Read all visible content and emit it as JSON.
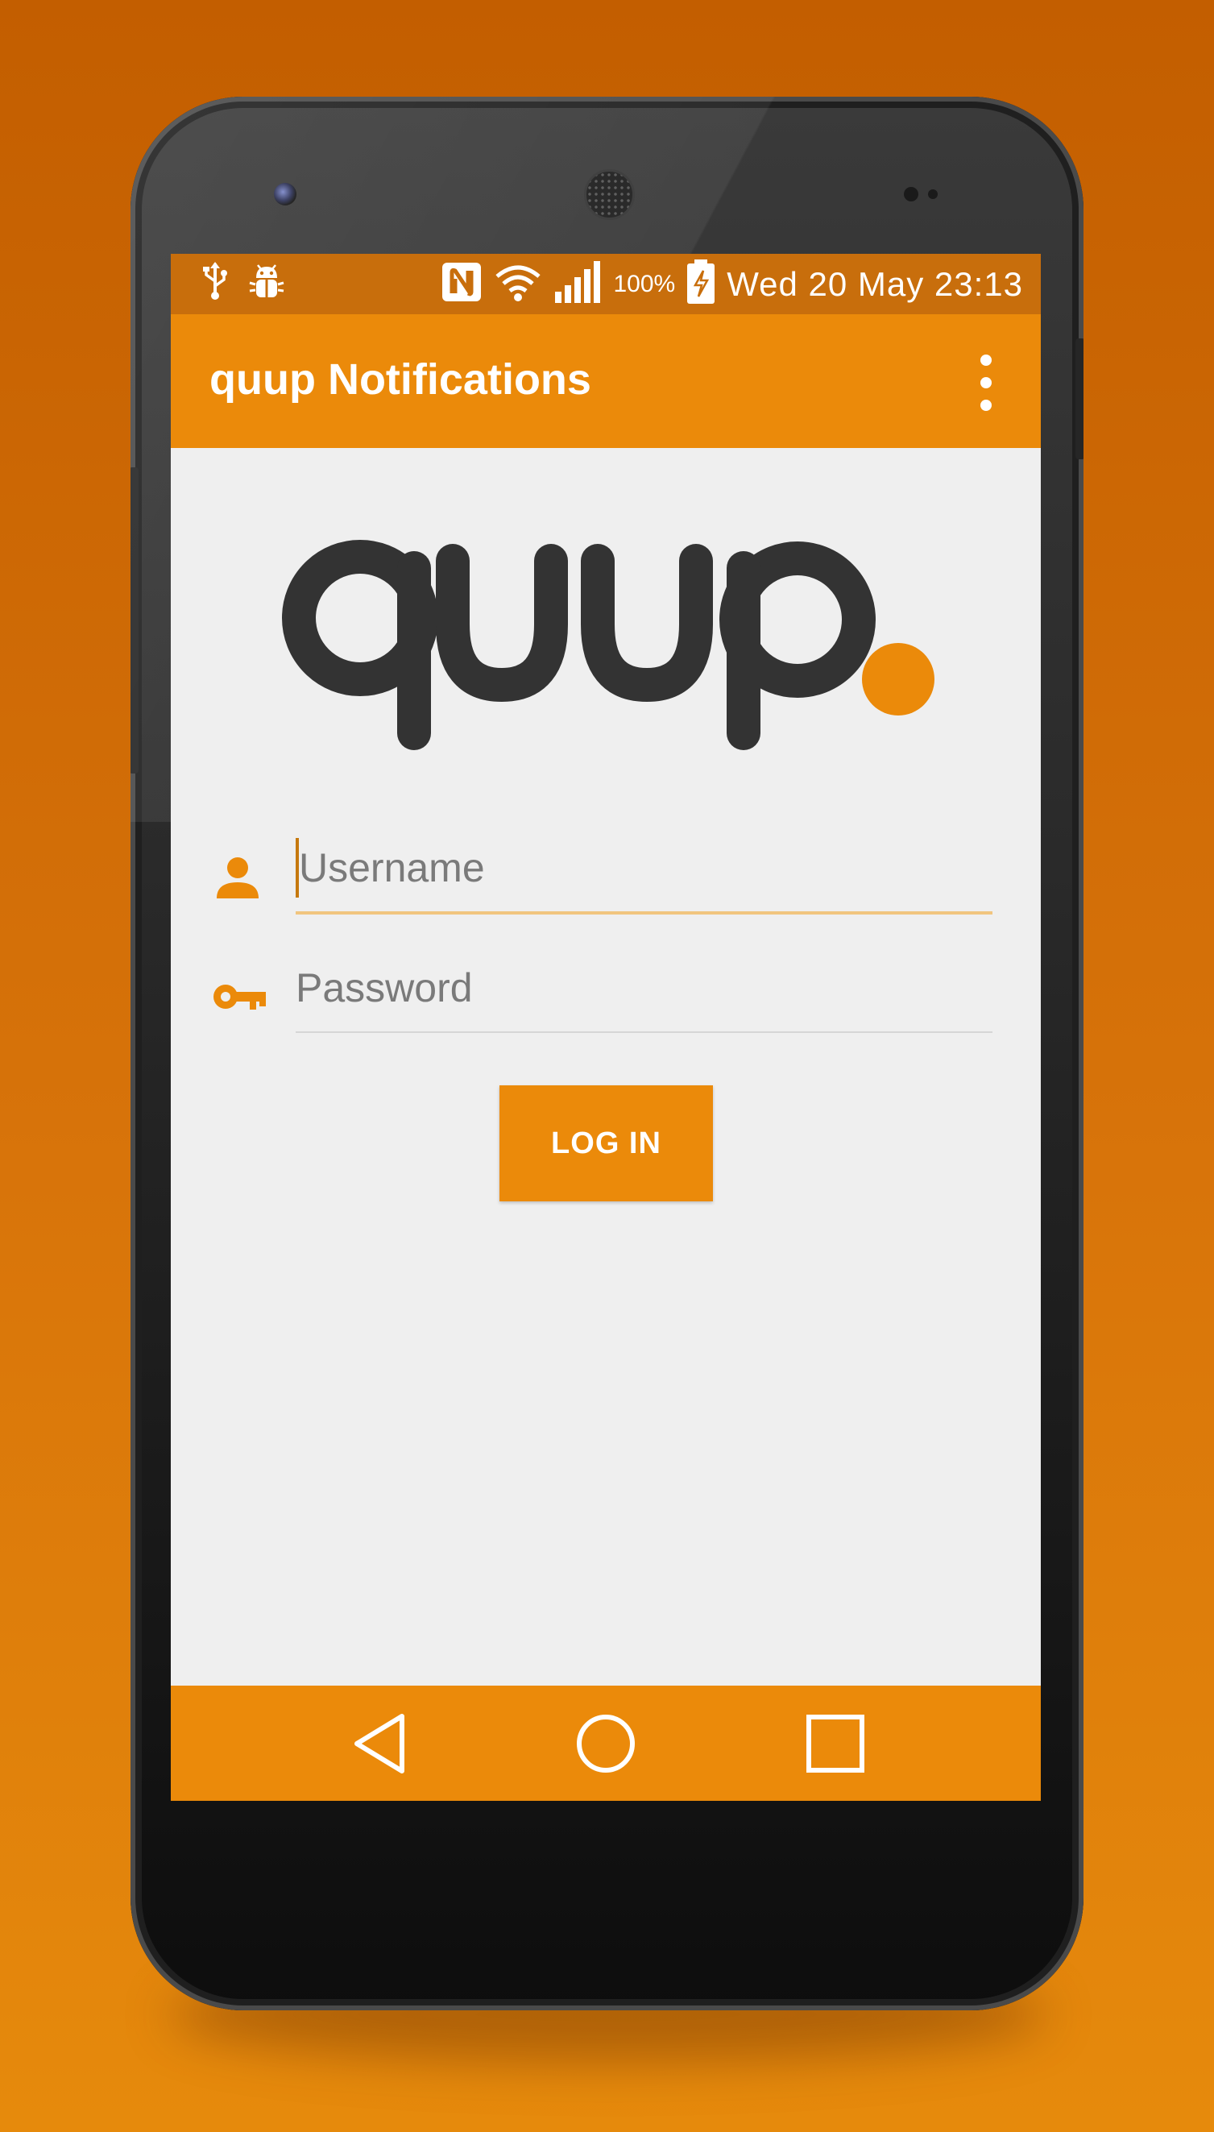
{
  "status_bar": {
    "icons": [
      "usb-icon",
      "android-debug-icon",
      "nfc-icon",
      "wifi-icon",
      "signal-icon",
      "battery-charging-icon"
    ],
    "battery_percent": "100%",
    "datetime": "Wed 20 May 23:13"
  },
  "app_bar": {
    "title": "quup Notifications",
    "menu_icon": "overflow-menu-icon"
  },
  "logo": {
    "text": "quup",
    "dot_color": "#eb8a0a",
    "letter_color": "#333333"
  },
  "form": {
    "username": {
      "placeholder": "Username",
      "value": "",
      "icon": "person-icon"
    },
    "password": {
      "placeholder": "Password",
      "value": "",
      "icon": "key-icon"
    },
    "login_label": "LOG IN"
  },
  "nav_bar": {
    "items": [
      "back-icon",
      "home-icon",
      "recents-icon"
    ]
  },
  "colors": {
    "accent": "#eb8a0a",
    "status_bar": "#c86e0c",
    "screen_bg": "#efefef"
  }
}
